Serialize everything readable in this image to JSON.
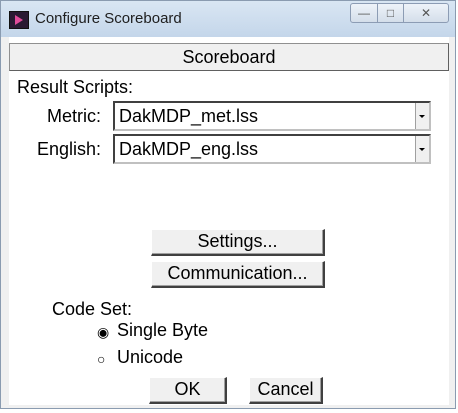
{
  "window": {
    "title": "Configure Scoreboard",
    "controls": {
      "minimize": "—",
      "maximize": "□",
      "close": "✕"
    },
    "app_icon": "scoreboard-app-icon"
  },
  "header": {
    "title": "Scoreboard"
  },
  "result_scripts": {
    "section_label": "Result Scripts:",
    "metric": {
      "label": "Metric:",
      "value": "DakMDP_met.lss"
    },
    "english": {
      "label": "English:",
      "value": "DakMDP_eng.lss"
    }
  },
  "buttons": {
    "settings": "Settings...",
    "communication": "Communication...",
    "ok": "OK",
    "cancel": "Cancel"
  },
  "code_set": {
    "label": "Code Set:",
    "options": [
      {
        "label": "Single Byte",
        "selected": true
      },
      {
        "label": "Unicode",
        "selected": false
      }
    ]
  },
  "colors": {
    "titlebar": "#c4d6ea",
    "dialog_bg": "#ffffff",
    "button_face": "#f0f0f0"
  }
}
